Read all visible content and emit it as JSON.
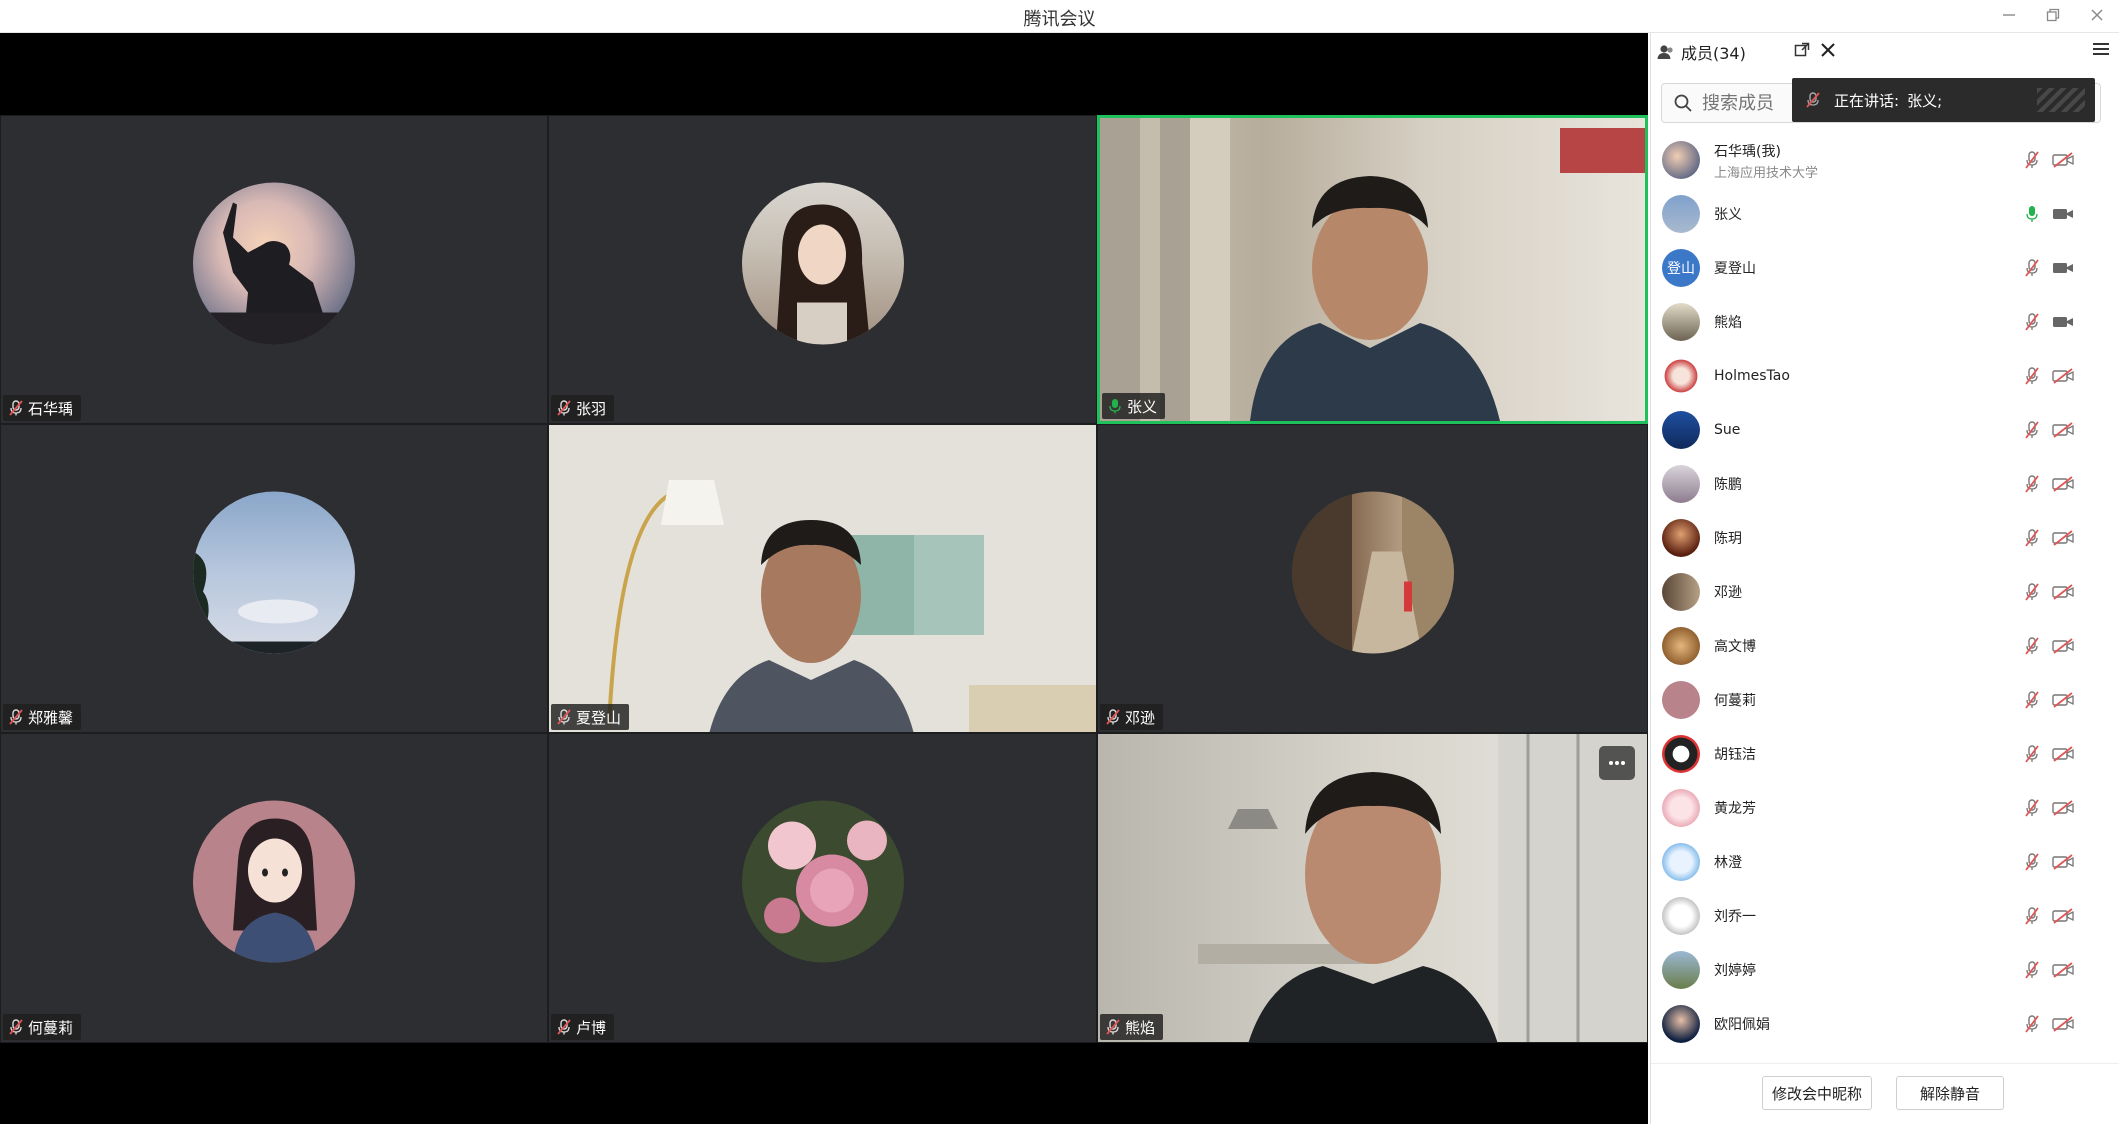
{
  "window": {
    "title": "腾讯会议"
  },
  "tiles": [
    {
      "name": "石华瑀",
      "mic": "muted"
    },
    {
      "name": "张羽",
      "mic": "muted"
    },
    {
      "name": "张义",
      "mic": "on"
    },
    {
      "name": "郑雅馨",
      "mic": "muted"
    },
    {
      "name": "夏登山",
      "mic": "muted"
    },
    {
      "name": "邓逊",
      "mic": "muted"
    },
    {
      "name": "何蔓莉",
      "mic": "muted"
    },
    {
      "name": "卢博",
      "mic": "muted"
    },
    {
      "name": "熊焰",
      "mic": "muted"
    }
  ],
  "panel": {
    "tab_label": "成员(34)",
    "search_placeholder": "搜索成员",
    "speaking_label": "正在讲话:",
    "speaking_name": "张义;",
    "members": [
      {
        "name": "石华瑀(我)",
        "sub": "上海应用技术大学",
        "mic": "muted",
        "cam": "off"
      },
      {
        "name": "张义",
        "sub": "",
        "mic": "on",
        "cam": "on"
      },
      {
        "name": "夏登山",
        "sub": "",
        "avatar_text": "登山",
        "mic": "muted",
        "cam": "on"
      },
      {
        "name": "熊焰",
        "sub": "",
        "mic": "muted",
        "cam": "on"
      },
      {
        "name": "HolmesTao",
        "sub": "",
        "mic": "muted",
        "cam": "off"
      },
      {
        "name": "Sue",
        "sub": "",
        "mic": "muted",
        "cam": "off"
      },
      {
        "name": "陈鹏",
        "sub": "",
        "mic": "muted",
        "cam": "off"
      },
      {
        "name": "陈玥",
        "sub": "",
        "mic": "muted",
        "cam": "off"
      },
      {
        "name": "邓逊",
        "sub": "",
        "mic": "muted",
        "cam": "off"
      },
      {
        "name": "高文博",
        "sub": "",
        "mic": "muted",
        "cam": "off"
      },
      {
        "name": "何蔓莉",
        "sub": "",
        "mic": "muted",
        "cam": "off"
      },
      {
        "name": "胡钰洁",
        "sub": "",
        "mic": "muted",
        "cam": "off"
      },
      {
        "name": "黄龙芳",
        "sub": "",
        "mic": "muted",
        "cam": "off"
      },
      {
        "name": "林澄",
        "sub": "",
        "mic": "muted",
        "cam": "off"
      },
      {
        "name": "刘乔一",
        "sub": "",
        "mic": "muted",
        "cam": "off"
      },
      {
        "name": "刘婷婷",
        "sub": "",
        "mic": "muted",
        "cam": "off"
      },
      {
        "name": "欧阳佩娟",
        "sub": "",
        "mic": "muted",
        "cam": "off"
      }
    ],
    "footer": {
      "rename_label": "修改会中昵称",
      "unmute_label": "解除静音"
    }
  },
  "colors": {
    "active_speaker": "#20c05c",
    "muted": "#e05555",
    "mic_on": "#22b14c",
    "tile_bg": "#2c2e31"
  }
}
